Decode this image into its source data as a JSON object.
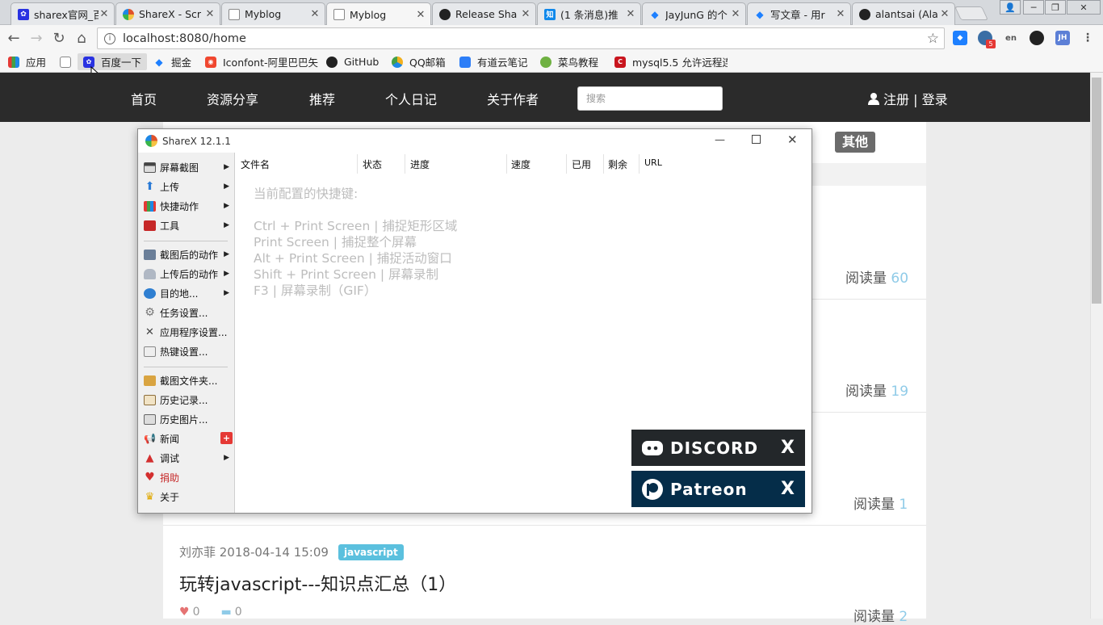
{
  "browser": {
    "tabs": [
      {
        "title": "sharex官网_百",
        "icon": "baidu-paw-icon",
        "color": "#2932e1"
      },
      {
        "title": "ShareX - Scr",
        "icon": "sharex-icon",
        "color": "#e0522b"
      },
      {
        "title": "Myblog",
        "icon": "page-icon",
        "color": "#888888"
      },
      {
        "title": "Myblog",
        "icon": "page-icon",
        "color": "#888888",
        "active": true
      },
      {
        "title": "Release Sha",
        "icon": "github-icon",
        "color": "#222222"
      },
      {
        "title": "(1 条消息)推",
        "icon": "zhihu-icon",
        "glyph": "知",
        "color": "#0f88eb"
      },
      {
        "title": "JayJunG 的个",
        "icon": "juejin-icon",
        "color": "#1e80ff"
      },
      {
        "title": "写文章 - 用r",
        "icon": "juejin-icon",
        "color": "#1e80ff"
      },
      {
        "title": "alantsai (Ala",
        "icon": "github-icon",
        "color": "#222222"
      }
    ],
    "url": "localhost:8080/home",
    "bookmarks": [
      {
        "label": "应用",
        "icon": "apps-grid-icon",
        "color": "#e53935"
      },
      {
        "label": "",
        "icon": "page-icon",
        "color": "#888888"
      },
      {
        "label": "百度一下",
        "icon": "baidu-paw-icon",
        "color": "#2932e1"
      },
      {
        "label": "掘金",
        "icon": "juejin-icon",
        "color": "#1e80ff"
      },
      {
        "label": "Iconfont-阿里巴巴矢",
        "icon": "iconfont-icon",
        "color": "#f0472f"
      },
      {
        "label": "GitHub",
        "icon": "github-icon",
        "color": "#222222"
      },
      {
        "label": "QQ邮箱",
        "icon": "qqmail-icon",
        "color": "#f2b01e"
      },
      {
        "label": "有道云笔记",
        "icon": "youdao-icon",
        "color": "#2d7ef7"
      },
      {
        "label": "菜鸟教程",
        "icon": "runoob-icon",
        "color": "#6fb142"
      },
      {
        "label": "mysql5.5 允许远程连",
        "icon": "csdn-icon",
        "color": "#c9151e"
      }
    ],
    "ext_badge": "5",
    "ext_jh": "JH",
    "ext_en": "en"
  },
  "site": {
    "nav": [
      "首页",
      "资源分享",
      "推荐",
      "个人日记",
      "关于作者"
    ],
    "search_placeholder": "搜索",
    "auth": "注册 | 登录",
    "category_other": "其他",
    "read_label": "阅读量",
    "read_counts": [
      "60",
      "19",
      "1",
      "2"
    ],
    "post": {
      "meta": "刘亦菲 2018-04-14 15:09",
      "tag": "javascript",
      "title": "玩转javascript---知识点汇总（1）",
      "likes": "0",
      "comments": "0"
    }
  },
  "sharex": {
    "title": "ShareX 12.1.1",
    "menu": [
      {
        "label": "屏幕截图",
        "icon": "screenshot-icon",
        "sub": true
      },
      {
        "label": "上传",
        "icon": "upload-arrow-icon",
        "sub": true
      },
      {
        "label": "快捷动作",
        "icon": "workflow-grid-icon",
        "sub": true
      },
      {
        "label": "工具",
        "icon": "toolbox-icon",
        "sub": true
      },
      {
        "label": "截图后的动作",
        "icon": "after-capture-icon",
        "sub": true
      },
      {
        "label": "上传后的动作",
        "icon": "after-upload-icon",
        "sub": true
      },
      {
        "label": "目的地...",
        "icon": "destinations-globe-icon",
        "sub": true
      },
      {
        "label": "任务设置...",
        "icon": "gear-icon",
        "sub": false
      },
      {
        "label": "应用程序设置...",
        "icon": "wrench-icon",
        "sub": false
      },
      {
        "label": "热键设置...",
        "icon": "keyboard-icon",
        "sub": false
      },
      {
        "label": "截图文件夹...",
        "icon": "folder-icon",
        "sub": false
      },
      {
        "label": "历史记录...",
        "icon": "history-icon",
        "sub": false
      },
      {
        "label": "历史图片...",
        "icon": "image-history-icon",
        "sub": false
      },
      {
        "label": "新闻",
        "icon": "megaphone-icon",
        "sub": false,
        "badge": "+"
      },
      {
        "label": "调试",
        "icon": "debug-cone-icon",
        "sub": true
      },
      {
        "label": "捐助",
        "icon": "heart-icon",
        "sub": false,
        "red": true
      },
      {
        "label": "关于",
        "icon": "crown-icon",
        "sub": false
      }
    ],
    "columns": [
      "文件名",
      "状态",
      "进度",
      "速度",
      "已用",
      "剩余",
      "URL"
    ],
    "hotkeys_header": "当前配置的快捷键:",
    "hotkeys": [
      "Ctrl + Print Screen  |  捕捉矩形区域",
      "Print Screen  |  捕捉整个屏幕",
      "Alt + Print Screen  |  捕捉活动窗口",
      "Shift + Print Screen  |  屏幕录制",
      "F3  |  屏幕录制（GIF）"
    ],
    "discord_label": "DISCORD",
    "patreon_label": "Patreon",
    "close_x": "X",
    "discord_color": "#23272a",
    "patreon_color": "#052d49"
  }
}
